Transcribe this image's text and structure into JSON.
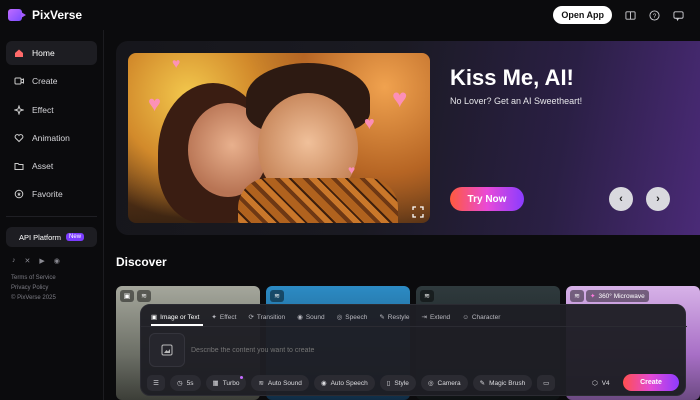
{
  "app": {
    "name": "PixVerse"
  },
  "topbar": {
    "open_app": "Open App",
    "icons": [
      "book-icon",
      "help-icon",
      "message-icon"
    ]
  },
  "sidebar": {
    "items": [
      {
        "label": "Home",
        "icon": "home-icon",
        "active": true
      },
      {
        "label": "Create",
        "icon": "create-icon"
      },
      {
        "label": "Effect",
        "icon": "sparkle-icon"
      },
      {
        "label": "Animation",
        "icon": "heart-icon"
      },
      {
        "label": "Asset",
        "icon": "folder-icon"
      },
      {
        "label": "Favorite",
        "icon": "favorite-icon"
      }
    ],
    "api_platform": "API Platform",
    "api_badge": "New",
    "socials": [
      "tiktok-icon",
      "x-icon",
      "youtube-icon",
      "discord-icon"
    ],
    "legal": [
      "Terms of Service",
      "Privacy Policy",
      "© PixVerse 2025"
    ]
  },
  "hero": {
    "title": "Kiss Me, AI!",
    "subtitle": "No Lover? Get an AI Sweetheart!",
    "cta": "Try Now",
    "prev": "‹",
    "next": "›"
  },
  "discover": {
    "title": "Discover",
    "card_badge": "360° Microwave"
  },
  "composer": {
    "tabs": [
      "Image or Text",
      "Effect",
      "Transition",
      "Sound",
      "Speech",
      "Restyle",
      "Extend",
      "Character"
    ],
    "placeholder": "Describe the content you want to create",
    "tools": [
      "5s",
      "Turbo",
      "Auto Sound",
      "Auto Speech",
      "Style",
      "Camera",
      "Magic Brush"
    ],
    "model": "V4",
    "create": "Create"
  },
  "colors": {
    "accent": "#8a3cff",
    "cta_start": "#ff5a3d",
    "cta_end": "#8a3cff"
  }
}
